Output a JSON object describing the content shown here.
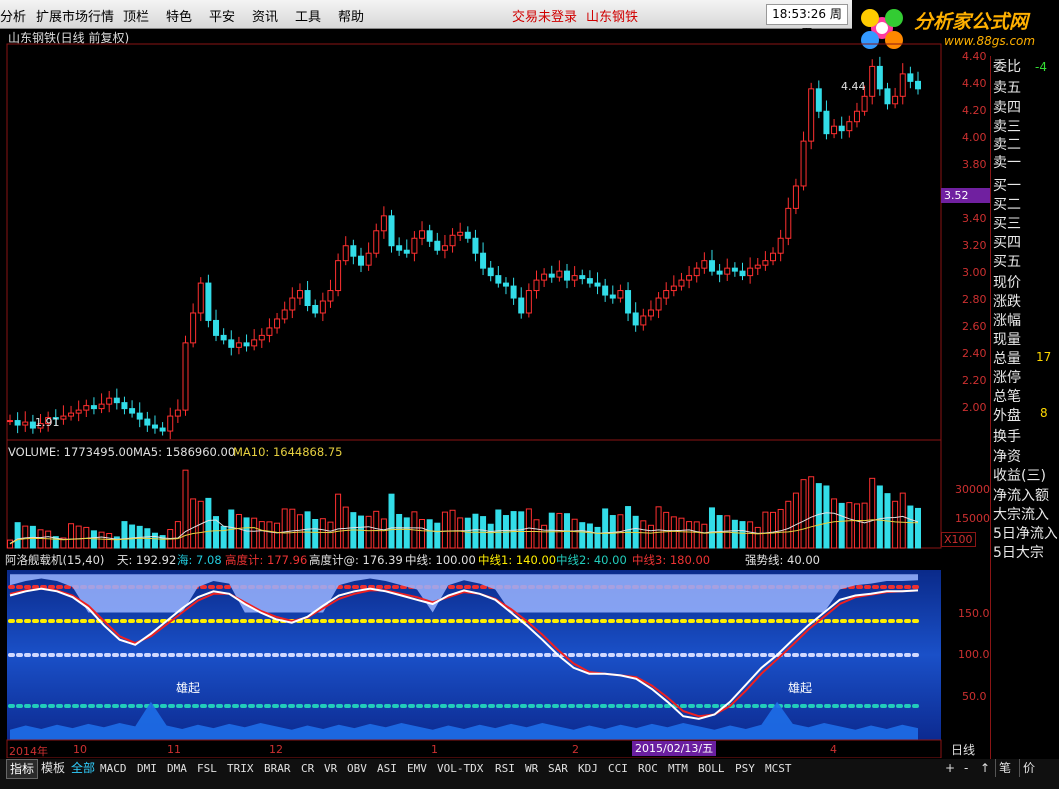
{
  "menu": {
    "items": [
      "分析",
      "扩展市场行情",
      "顶栏",
      "特色",
      "平安",
      "资讯",
      "工具",
      "帮助"
    ],
    "status": [
      "交易未登录",
      "山东钢铁"
    ],
    "clock": "18:53:26 周五"
  },
  "logo": {
    "text": "分析家公式网",
    "url": "www.88gs.com"
  },
  "main_chart": {
    "title": "山东钢铁(日线 前复权)",
    "y_ticks": [
      "4.40",
      "4.20",
      "4.00",
      "3.80",
      "3.60",
      "3.40",
      "3.20",
      "3.00",
      "2.80",
      "2.60",
      "2.40",
      "2.20",
      "2.00"
    ],
    "high_label": "4.44",
    "low_label": "1.91",
    "current_price": "3.52",
    "x100": "X100"
  },
  "volume": {
    "label": "VOLUME: 1773495.00",
    "ma5": "MA5: 1586960.00",
    "ma10": "MA10: 1644868.75",
    "y_ticks": [
      "30000",
      "15000"
    ]
  },
  "indicator": {
    "labels": [
      {
        "text": "阿洛舰载机(15,40)",
        "color": "#e0e0e0"
      },
      {
        "text": "天: 192.92",
        "color": "#e0e0e0"
      },
      {
        "text": "海: 7.08",
        "color": "#22ccdd"
      },
      {
        "text": "高度计: 177.96",
        "color": "#ee3333"
      },
      {
        "text": "高度计@: 176.39",
        "color": "#e0e0e0"
      },
      {
        "text": "中线: 100.00",
        "color": "#e0e0e0"
      },
      {
        "text": "中线1: 140.00",
        "color": "#ffee00"
      },
      {
        "text": "中线2: 40.00",
        "color": "#22ccbb"
      },
      {
        "text": "中线3: 180.00",
        "color": "#ee3333"
      },
      {
        "text": "强势线: 40.00",
        "color": "#e0e0e0"
      }
    ],
    "y_ticks": [
      "150.0",
      "100.0",
      "50.0"
    ],
    "annotations": [
      "雄起",
      "雄起"
    ]
  },
  "dates": {
    "labels": [
      "2014年",
      "10",
      "11",
      "12",
      "1",
      "2",
      "4"
    ],
    "cursor_date": "2015/02/13/五",
    "period": "日线"
  },
  "quote_panel": {
    "labels": [
      "委比",
      "卖五",
      "卖四",
      "卖三",
      "卖二",
      "卖一",
      "买一",
      "买二",
      "买三",
      "买四",
      "买五",
      "现价",
      "涨跌",
      "涨幅",
      "现量",
      "总量",
      "涨停",
      "总笔",
      "外盘",
      "换手",
      "净资",
      "收益(三)",
      "净流入额",
      "大宗流入",
      "5日净流入",
      "5日大宗"
    ],
    "values": [
      "-4",
      "17",
      "8"
    ]
  },
  "tabs": {
    "left": [
      "指标",
      "模板",
      "全部"
    ],
    "items": [
      "MACD",
      "DMI",
      "DMA",
      "FSL",
      "TRIX",
      "BRAR",
      "CR",
      "VR",
      "OBV",
      "ASI",
      "EMV",
      "VOL-TDX",
      "RSI",
      "WR",
      "SAR",
      "KDJ",
      "CCI",
      "ROC",
      "MTM",
      "BOLL",
      "PSY",
      "MCST"
    ],
    "right": [
      "+",
      "-",
      "↑",
      "笔",
      "价"
    ]
  },
  "chart_data": {
    "type": "candlestick",
    "title": "山东钢铁(日线 前复权)",
    "y_range": [
      1.85,
      4.5
    ],
    "closes": [
      1.98,
      1.95,
      1.97,
      1.93,
      1.96,
      2.0,
      1.99,
      2.01,
      2.03,
      2.05,
      2.08,
      2.06,
      2.09,
      2.13,
      2.1,
      2.06,
      2.03,
      1.99,
      1.95,
      1.93,
      1.91,
      2.01,
      2.05,
      2.5,
      2.7,
      2.9,
      2.65,
      2.55,
      2.52,
      2.47,
      2.5,
      2.48,
      2.52,
      2.55,
      2.6,
      2.66,
      2.72,
      2.8,
      2.85,
      2.75,
      2.7,
      2.78,
      2.85,
      3.05,
      3.15,
      3.08,
      3.02,
      3.1,
      3.25,
      3.35,
      3.15,
      3.12,
      3.1,
      3.2,
      3.25,
      3.18,
      3.12,
      3.15,
      3.22,
      3.24,
      3.2,
      3.1,
      3.0,
      2.95,
      2.9,
      2.88,
      2.8,
      2.7,
      2.85,
      2.92,
      2.96,
      2.94,
      2.98,
      2.92,
      2.95,
      2.93,
      2.9,
      2.88,
      2.82,
      2.8,
      2.85,
      2.7,
      2.62,
      2.68,
      2.72,
      2.8,
      2.85,
      2.88,
      2.92,
      2.95,
      3.0,
      3.05,
      2.98,
      2.96,
      3.0,
      2.98,
      2.95,
      3.0,
      3.02,
      3.05,
      3.1,
      3.2,
      3.4,
      3.55,
      3.85,
      4.2,
      4.05,
      3.9,
      3.95,
      3.92,
      3.98,
      4.05,
      4.15,
      4.35,
      4.2,
      4.1,
      4.15,
      4.3,
      4.25,
      4.2
    ],
    "indicator_lines": {
      "白线": [
        170,
        175,
        178,
        175,
        168,
        155,
        135,
        118,
        112,
        125,
        140,
        155,
        168,
        175,
        172,
        160,
        150,
        142,
        138,
        145,
        158,
        170,
        175,
        178,
        175,
        170,
        165,
        160,
        170,
        176,
        172,
        165,
        150,
        135,
        118,
        100,
        85,
        78,
        78,
        76,
        72,
        60,
        45,
        28,
        25,
        30,
        45,
        65,
        85,
        100,
        118,
        135,
        150,
        165,
        170,
        172,
        175,
        175,
        176
      ],
      "红线": [
        172,
        176,
        178,
        176,
        170,
        158,
        140,
        122,
        114,
        122,
        136,
        150,
        164,
        172,
        172,
        162,
        152,
        145,
        140,
        144,
        155,
        166,
        172,
        176,
        176,
        172,
        168,
        162,
        168,
        174,
        172,
        166,
        154,
        140,
        124,
        106,
        90,
        80,
        78,
        76,
        74,
        64,
        50,
        34,
        28,
        30,
        40,
        58,
        78,
        95,
        112,
        130,
        145,
        160,
        168,
        171,
        174,
        175,
        176
      ]
    }
  }
}
